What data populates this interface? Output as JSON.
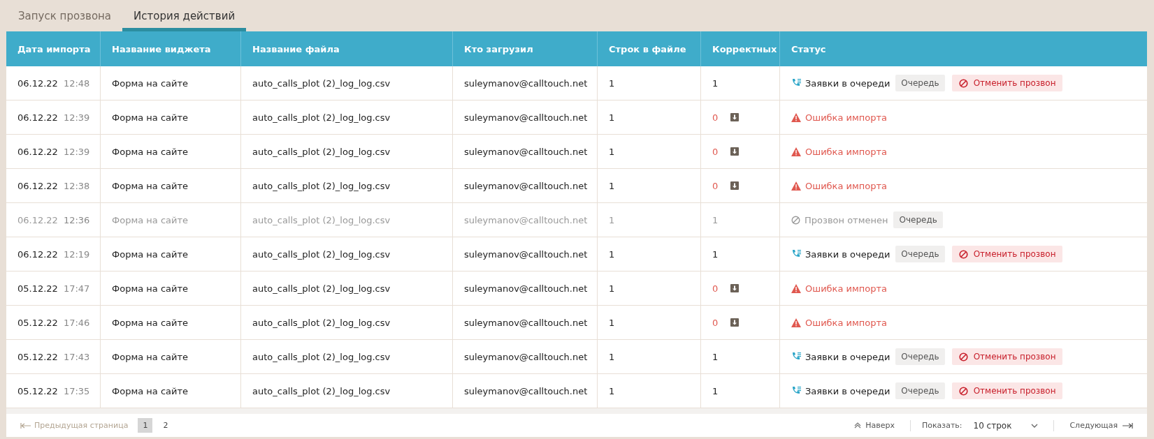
{
  "tabs": [
    {
      "label": "Запуск прозвона",
      "selected": false
    },
    {
      "label": "История действий",
      "selected": true
    }
  ],
  "table": {
    "columns": [
      "Дата импорта",
      "Название виджета",
      "Название файла",
      "Кто загрузил",
      "Строк в файле",
      "Корректных",
      "Статус"
    ],
    "rows": [
      {
        "date": "06.12.22",
        "time": "12:48",
        "widget": "Форма на сайте",
        "file": "auto_calls_plot (2)_log_log.csv",
        "user": "suleymanov@calltouch.net",
        "rows": "1",
        "correct": "1",
        "muted": false,
        "status": {
          "kind": "queued",
          "text": "Заявки в очереди",
          "queue": "Очередь",
          "cancel": "Отменить прозвон"
        }
      },
      {
        "date": "06.12.22",
        "time": "12:39",
        "widget": "Форма на сайте",
        "file": "auto_calls_plot (2)_log_log.csv",
        "user": "suleymanov@calltouch.net",
        "rows": "1",
        "correct": "0",
        "muted": false,
        "status": {
          "kind": "error",
          "text": "Ошибка импорта"
        }
      },
      {
        "date": "06.12.22",
        "time": "12:39",
        "widget": "Форма на сайте",
        "file": "auto_calls_plot (2)_log_log.csv",
        "user": "suleymanov@calltouch.net",
        "rows": "1",
        "correct": "0",
        "muted": false,
        "status": {
          "kind": "error",
          "text": "Ошибка импорта"
        }
      },
      {
        "date": "06.12.22",
        "time": "12:38",
        "widget": "Форма на сайте",
        "file": "auto_calls_plot (2)_log_log.csv",
        "user": "suleymanov@calltouch.net",
        "rows": "1",
        "correct": "0",
        "muted": false,
        "status": {
          "kind": "error",
          "text": "Ошибка импорта"
        }
      },
      {
        "date": "06.12.22",
        "time": "12:36",
        "widget": "Форма на сайте",
        "file": "auto_calls_plot (2)_log_log.csv",
        "user": "suleymanov@calltouch.net",
        "rows": "1",
        "correct": "1",
        "muted": true,
        "status": {
          "kind": "cancelled",
          "text": "Прозвон отменен",
          "queue": "Очередь"
        }
      },
      {
        "date": "06.12.22",
        "time": "12:19",
        "widget": "Форма на сайте",
        "file": "auto_calls_plot (2)_log_log.csv",
        "user": "suleymanov@calltouch.net",
        "rows": "1",
        "correct": "1",
        "muted": false,
        "status": {
          "kind": "queued",
          "text": "Заявки в очереди",
          "queue": "Очередь",
          "cancel": "Отменить прозвон"
        }
      },
      {
        "date": "05.12.22",
        "time": "17:47",
        "widget": "Форма на сайте",
        "file": "auto_calls_plot (2)_log_log.csv",
        "user": "suleymanov@calltouch.net",
        "rows": "1",
        "correct": "0",
        "muted": false,
        "status": {
          "kind": "error",
          "text": "Ошибка импорта"
        }
      },
      {
        "date": "05.12.22",
        "time": "17:46",
        "widget": "Форма на сайте",
        "file": "auto_calls_plot (2)_log_log.csv",
        "user": "suleymanov@calltouch.net",
        "rows": "1",
        "correct": "0",
        "muted": false,
        "status": {
          "kind": "error",
          "text": "Ошибка импорта"
        }
      },
      {
        "date": "05.12.22",
        "time": "17:43",
        "widget": "Форма на сайте",
        "file": "auto_calls_plot (2)_log_log.csv",
        "user": "suleymanov@calltouch.net",
        "rows": "1",
        "correct": "1",
        "muted": false,
        "status": {
          "kind": "queued",
          "text": "Заявки в очереди",
          "queue": "Очередь",
          "cancel": "Отменить прозвон"
        }
      },
      {
        "date": "05.12.22",
        "time": "17:35",
        "widget": "Форма на сайте",
        "file": "auto_calls_plot (2)_log_log.csv",
        "user": "suleymanov@calltouch.net",
        "rows": "1",
        "correct": "1",
        "muted": false,
        "status": {
          "kind": "queued",
          "text": "Заявки в очереди",
          "queue": "Очередь",
          "cancel": "Отменить прозвон"
        }
      }
    ]
  },
  "pagination": {
    "prev": {
      "label": "Предыдущая страница",
      "disabled": true
    },
    "pages": [
      {
        "label": "1",
        "selected": true
      },
      {
        "label": "2",
        "selected": false
      }
    ],
    "top": "Наверх",
    "show_label": "Показать:",
    "show_value": "10 строк",
    "next": {
      "label": "Следующая",
      "disabled": false
    }
  }
}
